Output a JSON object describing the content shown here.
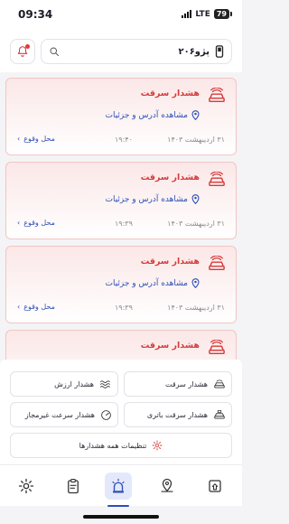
{
  "status_bar": {
    "time": "09:34",
    "network": "LTE",
    "battery": "79"
  },
  "header": {
    "vehicle_name": "پژو۲۰۶"
  },
  "alerts": [
    {
      "title": "هشدار سرقت",
      "address_link": "مشاهده آدرس و جزئیات",
      "date": "۳۱ اردیبهشت ۱۴۰۳",
      "time": "۱۹:۴۰",
      "location_label": "محل وقوع"
    },
    {
      "title": "هشدار سرقت",
      "address_link": "مشاهده آدرس و جزئیات",
      "date": "۳۱ اردیبهشت ۱۴۰۳",
      "time": "۱۹:۳۹",
      "location_label": "محل وقوع"
    },
    {
      "title": "هشدار سرقت",
      "address_link": "مشاهده آدرس و جزئیات",
      "date": "۳۱ اردیبهشت ۱۴۰۳",
      "time": "۱۹:۳۹",
      "location_label": "محل وقوع"
    },
    {
      "title": "هشدار سرقت",
      "address_link": "",
      "date": "",
      "time": "",
      "location_label": ""
    }
  ],
  "alert_types": {
    "theft": "هشدار سرقت",
    "vibration": "هشدار ارزش",
    "battery_theft": "هشدار سرقت باتری",
    "overspeed": "هشدار سرعت غیرمجاز",
    "all_settings": "تنظیمات همه هشدارها"
  },
  "colors": {
    "accent": "#2c4fb7",
    "alert_red": "#d63b3b",
    "alert_bg": "#fbe7e7"
  }
}
